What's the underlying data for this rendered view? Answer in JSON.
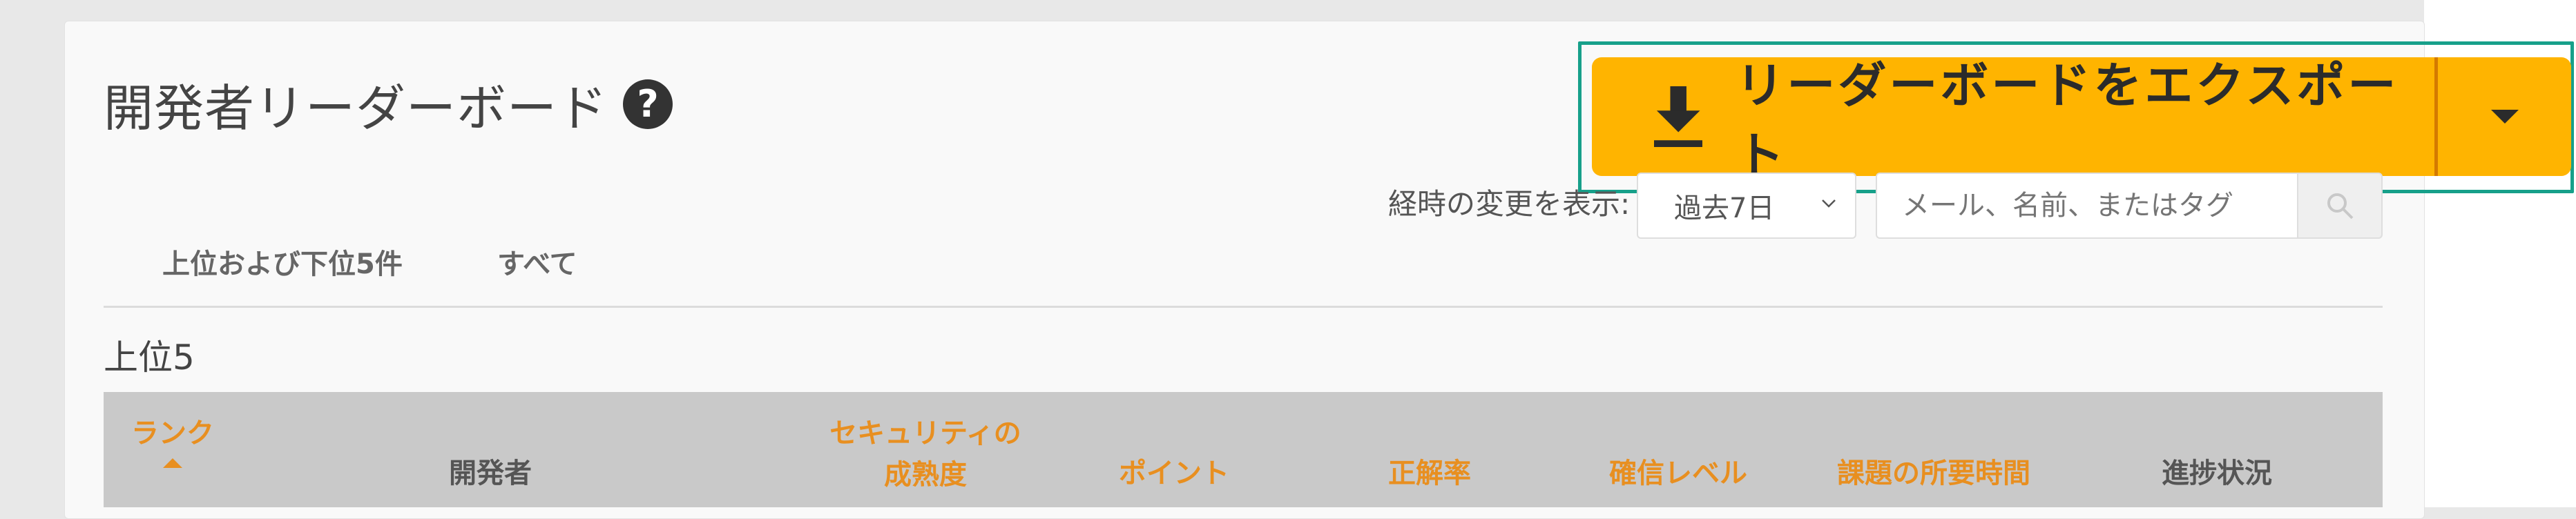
{
  "page_title": "開発者リーダーボード",
  "export": {
    "label": "リーダーボードをエクスポート"
  },
  "filters": {
    "time_label": "経時の変更を表示:",
    "time_range": "過去7日",
    "search_placeholder": "メール、名前、またはタグ"
  },
  "tabs": [
    {
      "label": "上位および下位5件"
    },
    {
      "label": "すべて"
    }
  ],
  "section_title": "上位5",
  "table": {
    "headers": [
      {
        "label": "ランク"
      },
      {
        "label": "開発者"
      },
      {
        "line1": "セキュリティの",
        "line2": "成熟度"
      },
      {
        "label": "ポイント"
      },
      {
        "label": "正解率"
      },
      {
        "label": "確信レベル"
      },
      {
        "label": "課題の所要時間"
      },
      {
        "label": "進捗状況"
      }
    ]
  },
  "colors": {
    "accent": "#ffb400",
    "header_text": "#e88f20",
    "highlight": "#17a08a"
  }
}
